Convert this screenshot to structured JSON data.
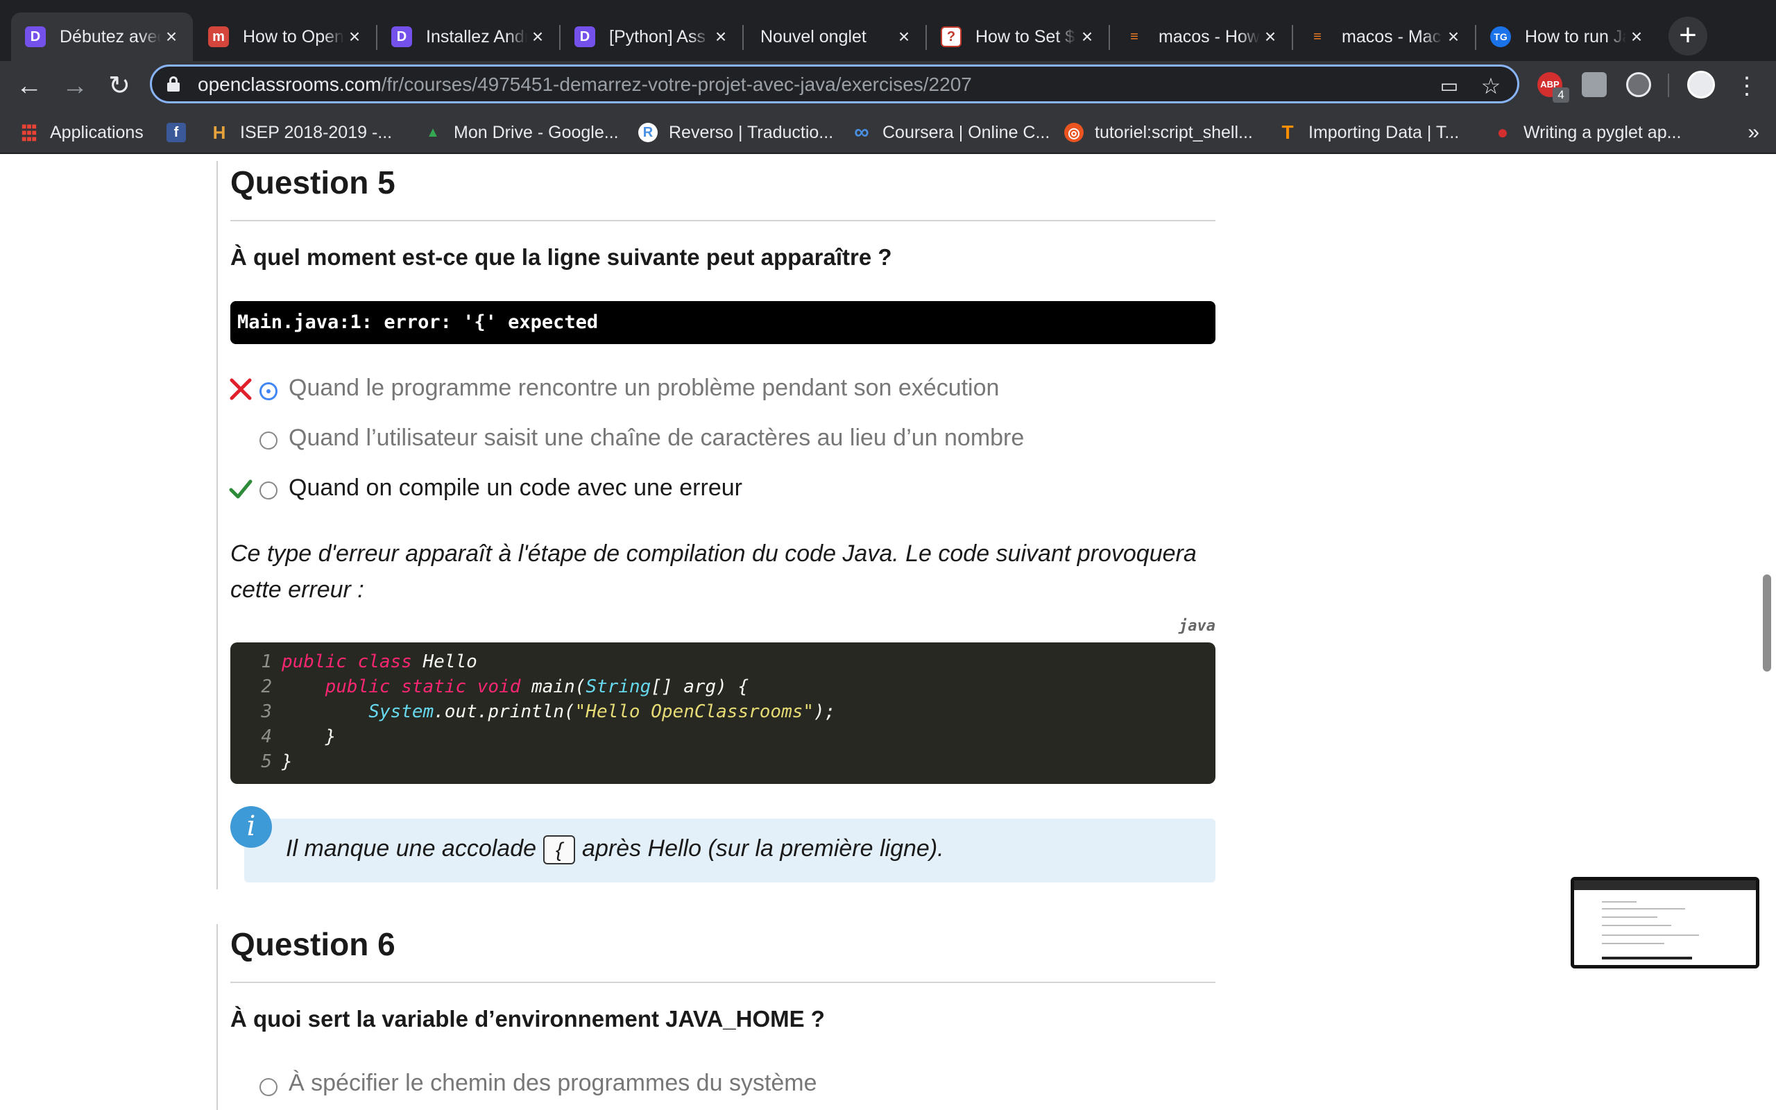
{
  "browser": {
    "tabs": [
      {
        "title": "Débutez avec Java",
        "icon": "openclassrooms-icon",
        "icon_glyph": "D",
        "icon_bg": "#7451eb",
        "active": true
      },
      {
        "title": "How to Open",
        "icon": "medium-icon",
        "icon_glyph": "m",
        "icon_bg": "#d4453c",
        "active": false
      },
      {
        "title": "Installez Android",
        "icon": "openclassrooms-icon",
        "icon_glyph": "D",
        "icon_bg": "#7451eb",
        "active": false
      },
      {
        "title": "[Python] Ass",
        "icon": "openclassrooms-icon",
        "icon_glyph": "D",
        "icon_bg": "#7451eb",
        "active": false
      },
      {
        "title": "Nouvel onglet",
        "icon": "",
        "icon_glyph": "",
        "icon_bg": "",
        "active": false
      },
      {
        "title": "How to Set $",
        "icon": "question-icon",
        "icon_glyph": "?",
        "icon_bg": "#c0392b",
        "active": false
      },
      {
        "title": "macos - How",
        "icon": "stackoverflow-icon",
        "icon_glyph": "≡",
        "icon_bg": "#f48024",
        "active": false
      },
      {
        "title": "macos - Mac",
        "icon": "stackoverflow-icon",
        "icon_glyph": "≡",
        "icon_bg": "#f48024",
        "active": false
      },
      {
        "title": "How to run Java",
        "icon": "tg-icon",
        "icon_glyph": "TG",
        "icon_bg": "#1a73e8",
        "active": false
      }
    ],
    "new_tab_label": "+",
    "url_host": "openclassrooms.com",
    "url_path": "/fr/courses/4975451-demarrez-votre-projet-avec-java/exercises/2207",
    "extension_badge": "4",
    "bookmarks": [
      {
        "label": "Applications",
        "icon": "apps-grid-icon",
        "glyph": "⋮⋮⋮",
        "color": "#ea4335"
      },
      {
        "label": "",
        "icon": "facebook-icon",
        "glyph": "f",
        "color": "#3b5998"
      },
      {
        "label": "ISEP 2018-2019 -...",
        "icon": "isep-icon",
        "glyph": "H",
        "color": "#e8a33d"
      },
      {
        "label": "Mon Drive - Google...",
        "icon": "google-drive-icon",
        "glyph": "▲",
        "color": "#34a853"
      },
      {
        "label": "Reverso | Traductio...",
        "icon": "reverso-icon",
        "glyph": "R",
        "color": "#4a90e2"
      },
      {
        "label": "Coursera | Online C...",
        "icon": "coursera-icon",
        "glyph": "∞",
        "color": "#2a73cc"
      },
      {
        "label": "tutoriel:script_shell...",
        "icon": "ubuntu-icon",
        "glyph": "◎",
        "color": "#e95420"
      },
      {
        "label": "Importing Data  |  T...",
        "icon": "tensorflow-icon",
        "glyph": "T",
        "color": "#ff8f00"
      },
      {
        "label": "Writing a pyglet ap...",
        "icon": "pyglet-icon",
        "glyph": "●",
        "color": "#d32f2f"
      }
    ],
    "bookmarks_more": "»"
  },
  "question5": {
    "title": "Question 5",
    "prompt": "À quel moment est-ce que la ligne suivante peut apparaître ?",
    "error_line": "Main.java:1: error: '{' expected",
    "answers": [
      {
        "text": "Quand le programme rencontre un problème pendant son exécution",
        "selected": true,
        "mark": "wrong"
      },
      {
        "text": "Quand l’utilisateur saisit une chaîne de caractères au lieu d’un nombre",
        "selected": false,
        "mark": ""
      },
      {
        "text": "Quand on compile un code avec une erreur",
        "selected": false,
        "mark": "correct"
      }
    ],
    "explanation": "Ce type d'erreur apparaît à l'étape de compilation du code Java. Le code suivant provoquera cette erreur :",
    "code_language": "java",
    "code": {
      "line_numbers": [
        "1",
        "2",
        "3",
        "4",
        "5"
      ],
      "l1_kw": "public class ",
      "l1_name": "Hello",
      "l2_indent": "    ",
      "l2_kw": "public static void ",
      "l2_fn": "main(",
      "l2_type": "String",
      "l2_rest": "[] arg) {",
      "l3_indent": "        ",
      "l3_type": "System",
      "l3_mid": ".out.println(",
      "l3_str": "\"Hello OpenClassrooms\"",
      "l3_end": ");",
      "l4": "    }",
      "l5": "}"
    },
    "info_before": "Il manque une accolade",
    "info_kbd": "{",
    "info_after": "après Hello (sur la première ligne)."
  },
  "question6": {
    "title": "Question 6",
    "prompt": "À quoi sert la variable d’environnement JAVA_HOME ?",
    "answers": [
      {
        "text": "À spécifier le chemin des programmes du système",
        "selected": false
      }
    ]
  },
  "colors": {
    "accent": "#4285f4",
    "wrong": "#e0202a",
    "correct": "#2e8b3a",
    "info_bg": "#e4f0f9",
    "info_icon": "#3e9ad6",
    "code_bg": "#272822"
  }
}
